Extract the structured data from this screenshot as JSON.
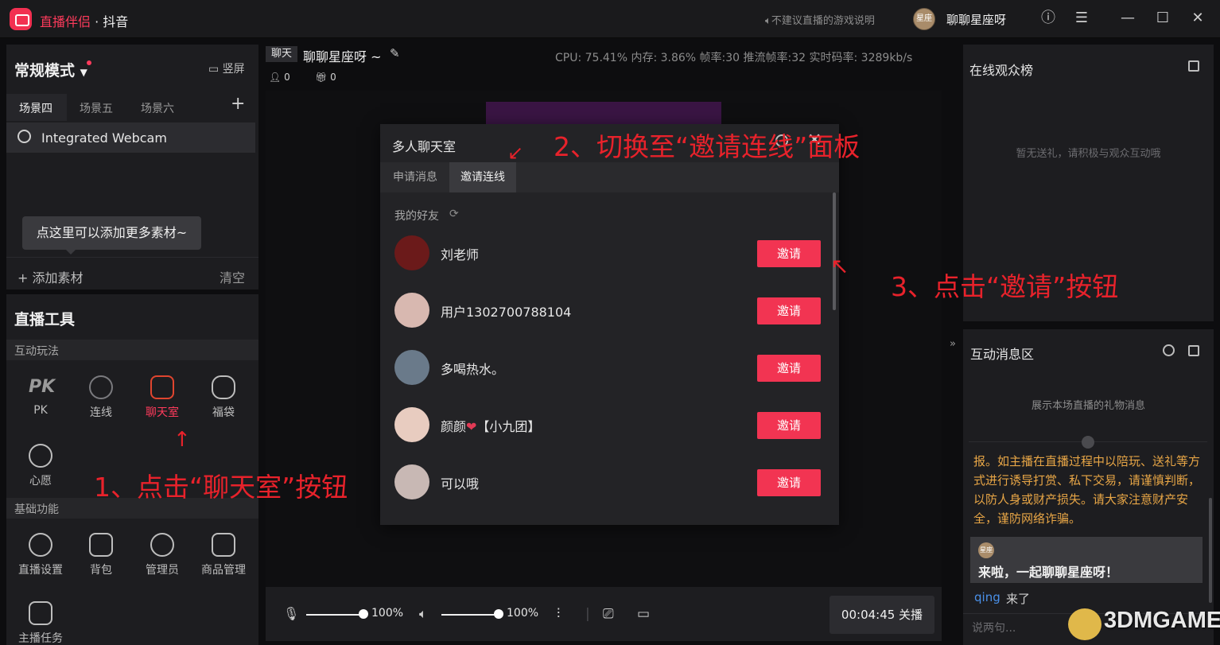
{
  "titlebar": {
    "app_brand": "直播伴侣",
    "app_sep": " · ",
    "app_platform": "抖音",
    "game_notice": "不建议直播的游戏说明",
    "avatar_text": "星座",
    "username": "聊聊星座呀"
  },
  "left": {
    "mode": "常规模式",
    "portrait_btn": "竖屏",
    "scenes": [
      "场景四",
      "场景五",
      "场景六"
    ],
    "source": "Integrated Webcam",
    "tooltip": "点这里可以添加更多素材~",
    "add_source": "添加素材",
    "clear": "清空",
    "tools_title": "直播工具",
    "section_interactive": "互动玩法",
    "interactive_tools": [
      "PK",
      "连线",
      "聊天室",
      "福袋",
      "心愿"
    ],
    "section_basic": "基础功能",
    "basic_tools": [
      "直播设置",
      "背包",
      "管理员",
      "商品管理",
      "主播任务"
    ]
  },
  "center": {
    "tag": "聊天",
    "stream_title": "聊聊星座呀 ~",
    "stats": "CPU: 75.41%    内存: 3.86%    帧率:30    推流帧率:32    实时码率: 3289kb/s",
    "viewer_count": "0",
    "gift_count": "0",
    "mic_volume": "100%",
    "speaker_volume": "100%",
    "live_timer": "00:04:45 关播"
  },
  "modal": {
    "title": "多人聊天室",
    "tabs": [
      "申请消息",
      "邀请连线"
    ],
    "friends_label": "我的好友",
    "invite_label": "邀请",
    "friends": [
      {
        "name": "刘老师",
        "color": "#6b1a1a"
      },
      {
        "name": "用户1302700788104",
        "color": "#d8b8b0"
      },
      {
        "name": "多喝热水。",
        "color": "#6a7a8a"
      },
      {
        "name": "颜颜",
        "badge": "【小九团】",
        "color": "#e8ccc0"
      },
      {
        "name": "可以哦",
        "color": "#c8b8b4"
      }
    ]
  },
  "right": {
    "viewers_title": "在线观众榜",
    "no_gifts": "暂无送礼，请积极与观众互动哦",
    "interact_title": "互动消息区",
    "gift_hint": "展示本场直播的礼物消息",
    "notice": "报。如主播在直播过程中以陪玩、送礼等方式进行诱导打赏、私下交易，请谨慎判断，以防人身或财产损失。请大家注意财产安全，谨防网络诈骗。",
    "welcome_avatar": "星座",
    "welcome": "来啦，一起聊聊星座呀！",
    "join_user": "qing",
    "join_text": "来了",
    "chat_placeholder": "说两句..."
  },
  "annotations": {
    "step1": "1、点击“聊天室”按钮",
    "step2": "2、切换至“邀请连线”面板",
    "step3": "3、点击“邀请”按钮"
  },
  "watermark": "3DMGAME",
  "colors": {
    "accent": "#f23452",
    "annotation": "#e8222b",
    "notice": "#e8a646",
    "link": "#4a90e8"
  }
}
